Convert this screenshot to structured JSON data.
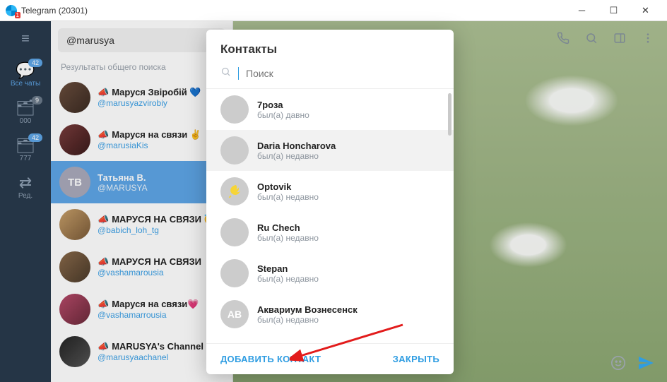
{
  "window": {
    "title": "Telegram (20301)",
    "logo_badge": "1"
  },
  "folderbar": {
    "tabs": [
      {
        "icon": "💬",
        "label": "Все чаты",
        "badge": "42",
        "active": true
      },
      {
        "icon": "📁",
        "label": "000",
        "badge": "9",
        "active": false
      },
      {
        "icon": "📁",
        "label": "777",
        "badge": "42",
        "active": false
      },
      {
        "icon": "⇄",
        "label": "Ред.",
        "badge": "",
        "active": false
      }
    ]
  },
  "search": {
    "value": "@marusya",
    "results_header": "Результаты общего поиска"
  },
  "chats": [
    {
      "name": "Маруся Звіробій 💙",
      "sub": "@marusyazvirobiy",
      "avatar_text": "",
      "selected": false
    },
    {
      "name": "Маруся на связи ✌",
      "sub": "@marusiaKis",
      "avatar_text": "",
      "selected": false
    },
    {
      "name": "Татьяна В.",
      "sub": "@MARUSYA",
      "avatar_text": "ТВ",
      "selected": true
    },
    {
      "name": "МАРУСЯ НА СВЯЗИ 😇",
      "sub": "@babich_loh_tg",
      "avatar_text": "",
      "selected": false
    },
    {
      "name": "МАРУСЯ НА СВЯЗИ",
      "sub": "@vashamarousia",
      "avatar_text": "",
      "selected": false
    },
    {
      "name": "Маруся на связи💗",
      "sub": "@vashamarrousia",
      "avatar_text": "",
      "selected": false
    },
    {
      "name": "MARUSYA's Channel",
      "sub": "@marusyaachanel",
      "avatar_text": "",
      "selected": false
    }
  ],
  "header_icons": {
    "call": "call-icon",
    "search": "search-icon",
    "panel": "sidebar-icon",
    "more": "more-icon"
  },
  "composer": {
    "smile": "smile",
    "send": "send"
  },
  "contacts_modal": {
    "title": "Контакты",
    "search_placeholder": "Поиск",
    "items": [
      {
        "name": "7роза",
        "status": "был(а) давно",
        "avatar_text": "",
        "avatar_cls": "av-tan",
        "hover": false
      },
      {
        "name": "Daria Honcharova",
        "status": "был(а) недавно",
        "avatar_text": "",
        "avatar_cls": "av-tan",
        "hover": true
      },
      {
        "name": "Optovik",
        "status": "был(а) недавно",
        "avatar_text": "",
        "avatar_cls": "av-red",
        "hover": false
      },
      {
        "name": "Ru Chech",
        "status": "был(а) недавно",
        "avatar_text": "",
        "avatar_cls": "av-cat",
        "hover": false
      },
      {
        "name": "Stepan",
        "status": "был(а) недавно",
        "avatar_text": "",
        "avatar_cls": "av-blue",
        "hover": false
      },
      {
        "name": "Аквариум Вознесенск",
        "status": "был(а) недавно",
        "avatar_text": "АВ",
        "avatar_cls": "av-mag",
        "hover": false
      }
    ],
    "add_button": "ДОБАВИТЬ КОНТАКТ",
    "close_button": "ЗАКРЫТЬ"
  }
}
